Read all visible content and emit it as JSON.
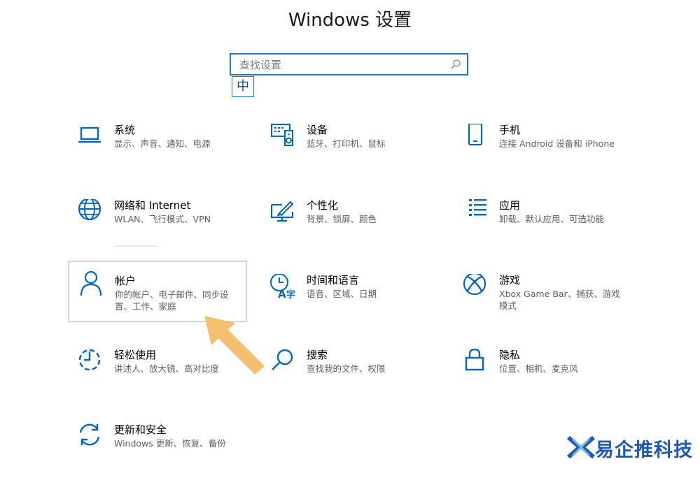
{
  "window": {
    "title": "Windows 设置"
  },
  "search": {
    "placeholder": "查找设置",
    "ime_indicator": "中"
  },
  "tiles": [
    {
      "name": "系统",
      "desc": "显示、声音、通知、电源",
      "icon": "laptop-icon"
    },
    {
      "name": "设备",
      "desc": "蓝牙、打印机、鼠标",
      "icon": "keyboard-speaker-icon"
    },
    {
      "name": "手机",
      "desc": "连接 Android 设备和 iPhone",
      "icon": "phone-icon"
    },
    {
      "name": "网络和 Internet",
      "desc": "WLAN、飞行模式、VPN",
      "icon": "globe-icon"
    },
    {
      "name": "个性化",
      "desc": "背景、锁屏、颜色",
      "icon": "paintbrush-monitor-icon"
    },
    {
      "name": "应用",
      "desc": "卸载、默认应用、可选功能",
      "icon": "list-icon"
    },
    {
      "name": "帐户",
      "desc": "你的帐户、电子邮件、同步设置、工作、家庭",
      "icon": "person-icon"
    },
    {
      "name": "时间和语言",
      "desc": "语音、区域、日期",
      "icon": "clock-language-icon"
    },
    {
      "name": "游戏",
      "desc": "Xbox Game Bar、捕获、游戏模式",
      "icon": "xbox-icon"
    },
    {
      "name": "轻松使用",
      "desc": "讲述人、放大镜、高对比度",
      "icon": "timer-dashed-icon"
    },
    {
      "name": "搜索",
      "desc": "查找我的文件、权限",
      "icon": "magnifier-icon"
    },
    {
      "name": "隐私",
      "desc": "位置、相机、麦克风",
      "icon": "padlock-icon"
    },
    {
      "name": "更新和安全",
      "desc": "Windows 更新、恢复、备份",
      "icon": "sync-arrows-icon"
    }
  ],
  "watermark": {
    "text": "易企推科技"
  },
  "colors": {
    "accent": "#0067c0",
    "search_border": "#1979ca",
    "arrow": "#f4c070",
    "watermark": "#1f58b8"
  }
}
